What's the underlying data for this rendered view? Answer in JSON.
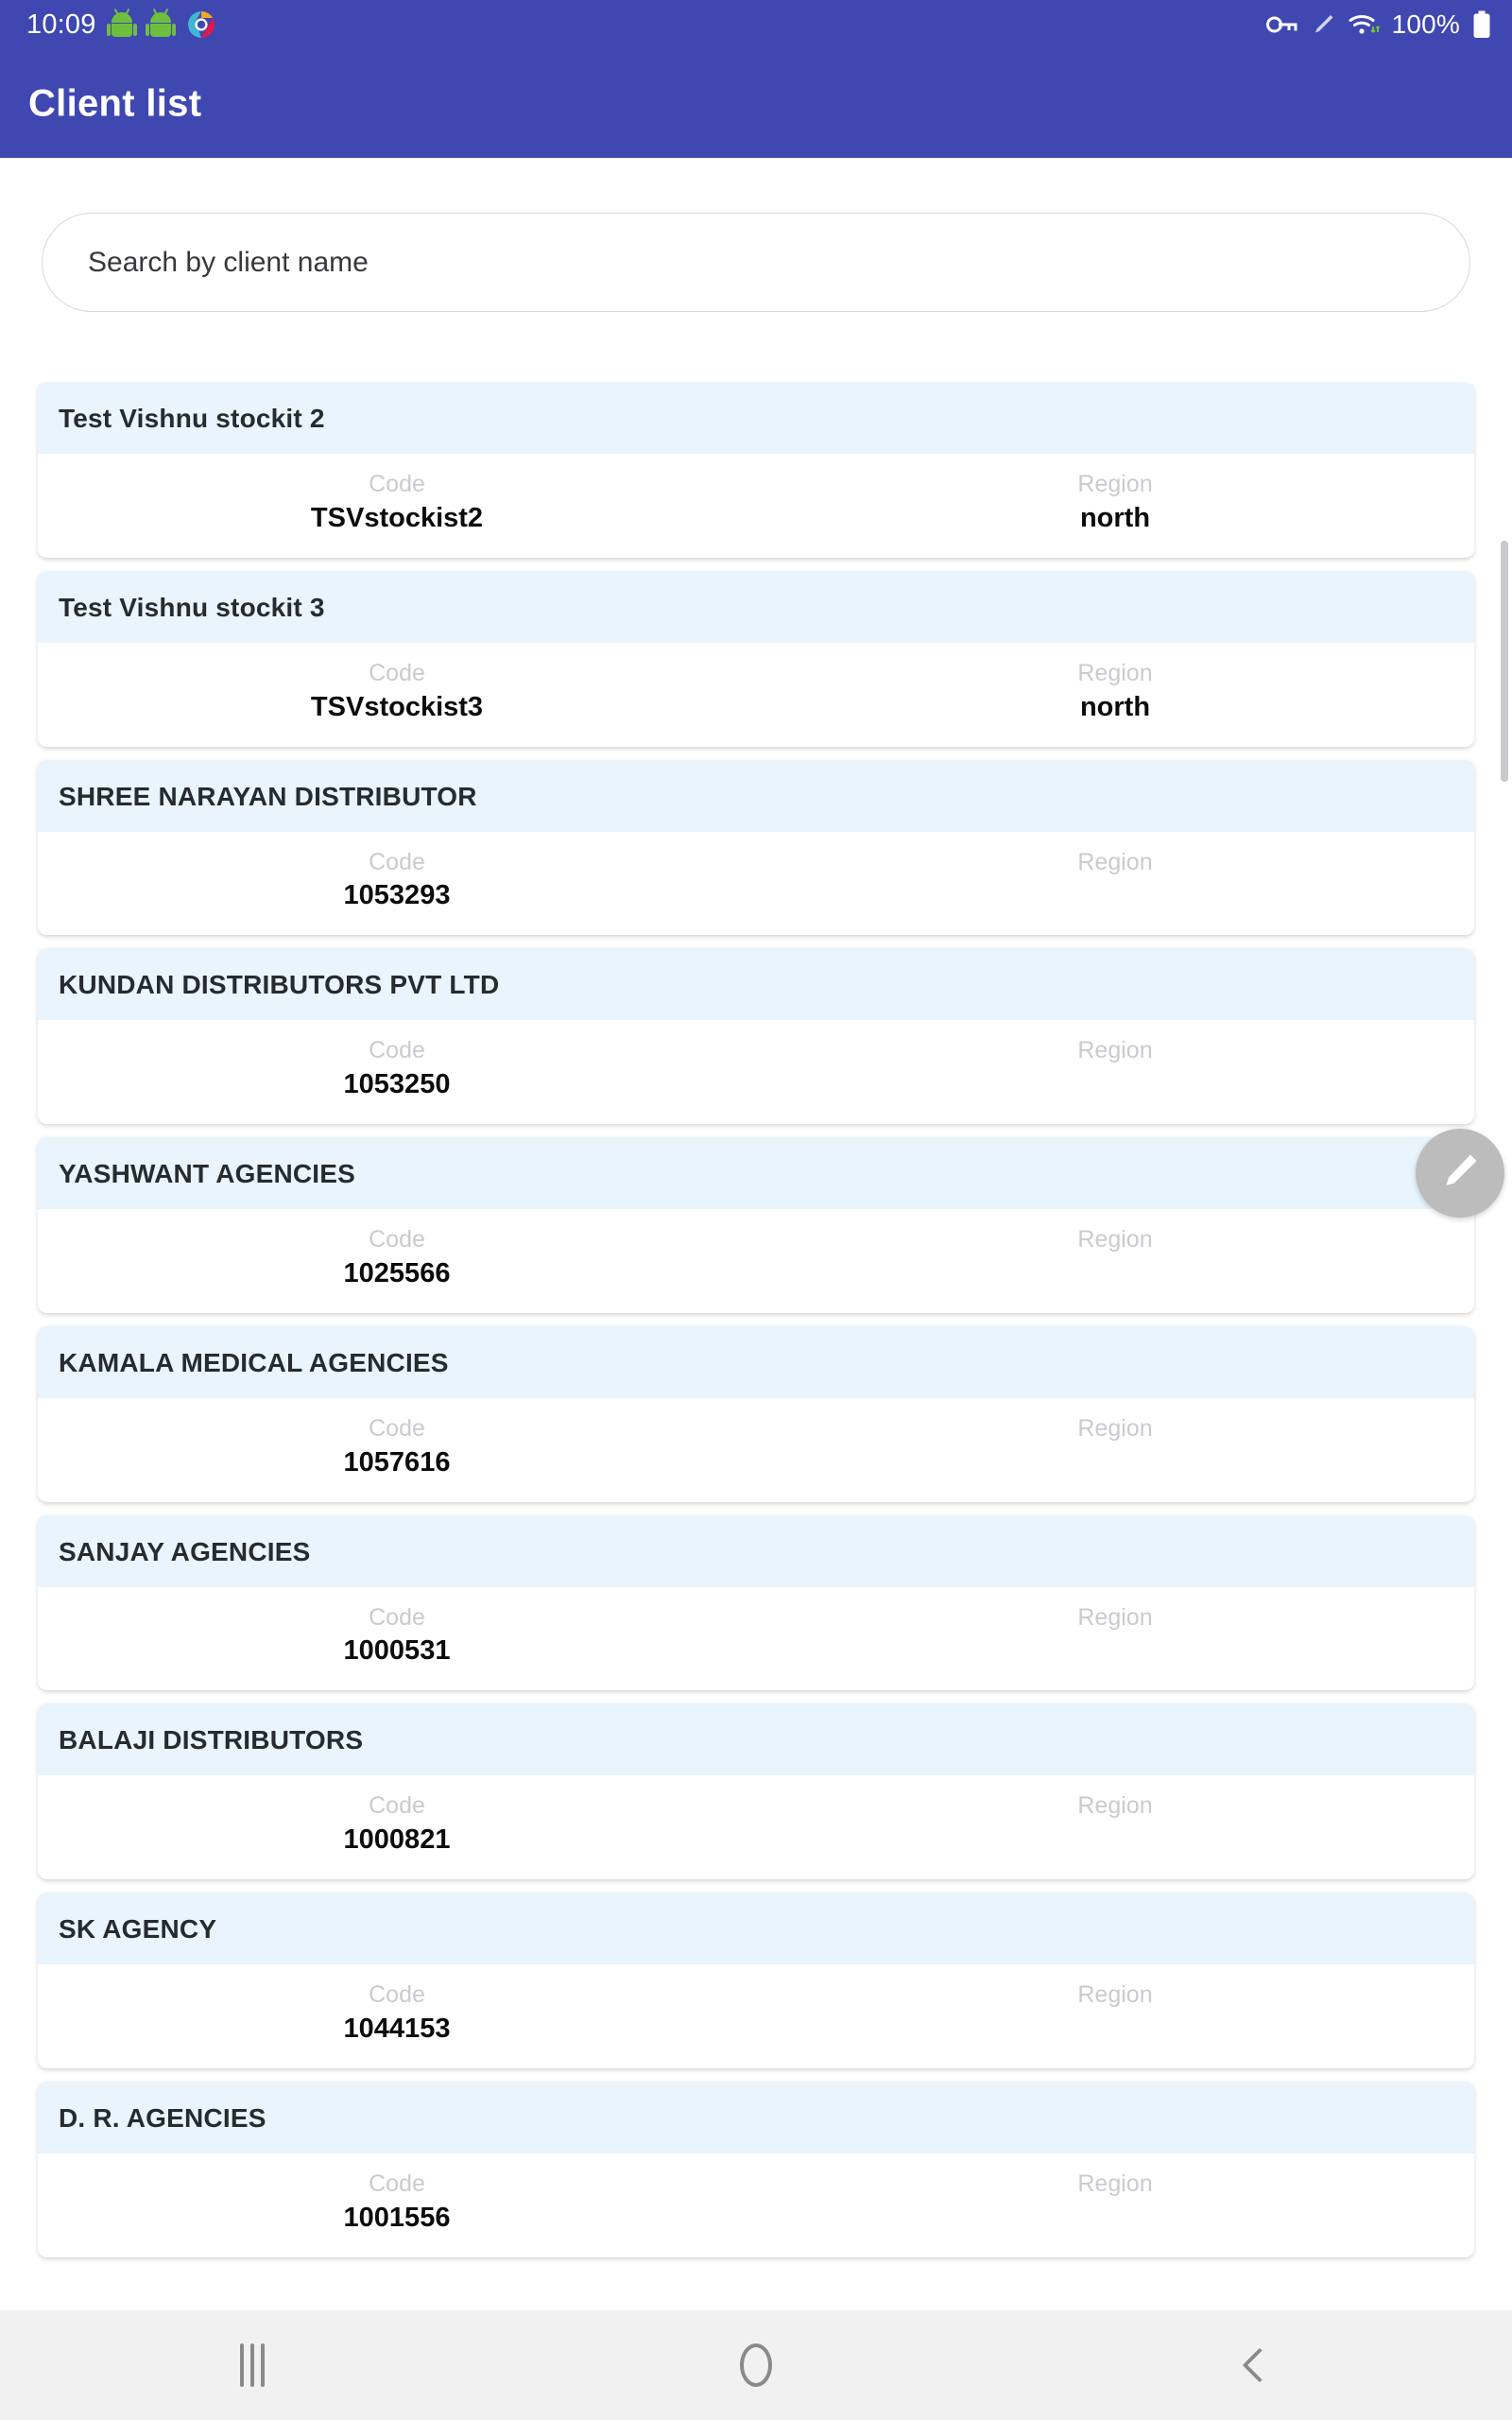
{
  "status_bar": {
    "time": "10:09",
    "battery_percent": "100%",
    "icons": [
      "android-robot-icon",
      "android-robot-icon",
      "app-logo-icon",
      "vpn-key-icon",
      "stylus-pen-icon",
      "wifi-icon",
      "battery-full-icon"
    ]
  },
  "app_bar": {
    "title": "Client list"
  },
  "search": {
    "placeholder": "Search by client name",
    "value": ""
  },
  "columns": {
    "code_label": "Code",
    "region_label": "Region"
  },
  "clients": [
    {
      "name": "Test Vishnu stockit 2",
      "code": "TSVstockist2",
      "region": "north"
    },
    {
      "name": "Test Vishnu stockit 3",
      "code": "TSVstockist3",
      "region": "north"
    },
    {
      "name": "SHREE NARAYAN DISTRIBUTOR",
      "code": "1053293",
      "region": ""
    },
    {
      "name": "KUNDAN DISTRIBUTORS PVT LTD",
      "code": "1053250",
      "region": ""
    },
    {
      "name": "YASHWANT AGENCIES",
      "code": "1025566",
      "region": ""
    },
    {
      "name": "KAMALA MEDICAL AGENCIES",
      "code": "1057616",
      "region": ""
    },
    {
      "name": "SANJAY AGENCIES",
      "code": "1000531",
      "region": ""
    },
    {
      "name": "BALAJI  DISTRIBUTORS",
      "code": "1000821",
      "region": ""
    },
    {
      "name": "SK AGENCY",
      "code": "1044153",
      "region": ""
    },
    {
      "name": "D. R. AGENCIES",
      "code": "1001556",
      "region": ""
    }
  ],
  "fab": {
    "icon": "edit-pencil-icon"
  },
  "nav_bar": {
    "recents_label": "Recents",
    "home_label": "Home",
    "back_label": "Back"
  },
  "colors": {
    "app_bar": "#3F47B0",
    "card_header": "#e9f4fd",
    "card_body": "#ffffff",
    "label_grey": "#c9cbcf",
    "fab": "#bcbcbd",
    "nav_bar": "#f1f1f1"
  }
}
